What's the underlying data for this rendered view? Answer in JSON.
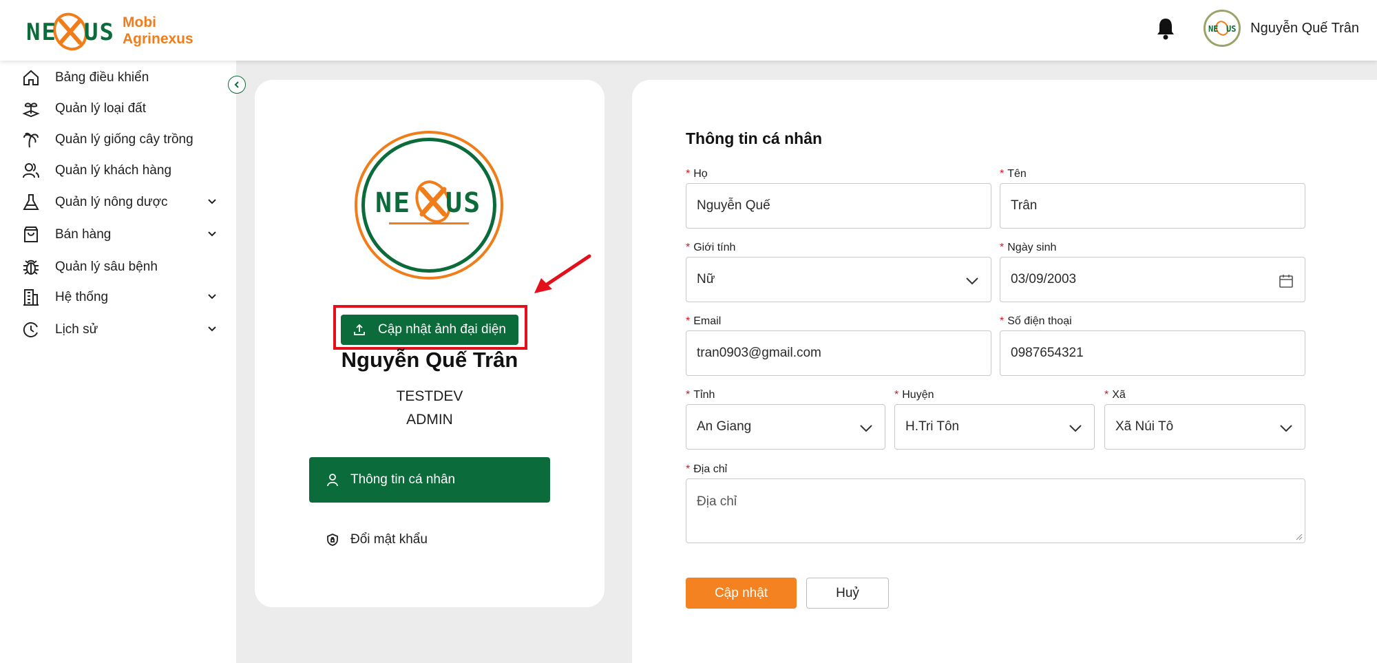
{
  "brand": {
    "line1": "Mobi",
    "line2": "Agrinexus",
    "logo_text": "NEXUS",
    "orange": "#f07d1a",
    "green": "#0b6b3a"
  },
  "header": {
    "user_name": "Nguyễn Quế Trân",
    "bell_icon": "bell-icon"
  },
  "sidebar": {
    "items": [
      {
        "label": "Bảng điều khiển",
        "icon": "home-icon",
        "expandable": false
      },
      {
        "label": "Quản lý loại đất",
        "icon": "soil-sprout-icon",
        "expandable": false
      },
      {
        "label": "Quản lý giống cây trồng",
        "icon": "palm-tree-icon",
        "expandable": false
      },
      {
        "label": "Quản lý khách hàng",
        "icon": "users-icon",
        "expandable": false
      },
      {
        "label": "Quản lý nông dược",
        "icon": "flask-icon",
        "expandable": true
      },
      {
        "label": "Bán hàng",
        "icon": "shopping-bag-icon",
        "expandable": true
      },
      {
        "label": "Quản lý sâu bệnh",
        "icon": "bug-icon",
        "expandable": false
      },
      {
        "label": "Hệ thống",
        "icon": "building-icon",
        "expandable": true
      },
      {
        "label": "Lịch sử",
        "icon": "clock-icon",
        "expandable": true
      }
    ]
  },
  "profile": {
    "upload_label": "Cập nhật ảnh đại diện",
    "name": "Nguyễn Quế Trân",
    "organization": "TESTDEV",
    "role": "ADMIN",
    "menu_personal": "Thông tin cá nhân",
    "menu_password": "Đổi mật khẩu",
    "highlight_color": "#e3101b"
  },
  "form": {
    "title": "Thông tin cá nhân",
    "last_name": {
      "label": "Họ",
      "value": "Nguyễn Quế"
    },
    "first_name": {
      "label": "Tên",
      "value": "Trân"
    },
    "gender": {
      "label": "Giới tính",
      "value": "Nữ"
    },
    "birthday": {
      "label": "Ngày sinh",
      "value": "03/09/2003"
    },
    "email": {
      "label": "Email",
      "value": "tran0903@gmail.com"
    },
    "phone": {
      "label": "Số điện thoại",
      "value": "0987654321"
    },
    "province": {
      "label": "Tỉnh",
      "value": "An Giang"
    },
    "district": {
      "label": "Huyện",
      "value": "H.Tri Tôn"
    },
    "ward": {
      "label": "Xã",
      "value": "Xã Núi Tô"
    },
    "address": {
      "label": "Địa chỉ",
      "placeholder": "Địa chỉ"
    },
    "submit_label": "Cập nhật",
    "cancel_label": "Huỷ",
    "required_mark": "*"
  }
}
